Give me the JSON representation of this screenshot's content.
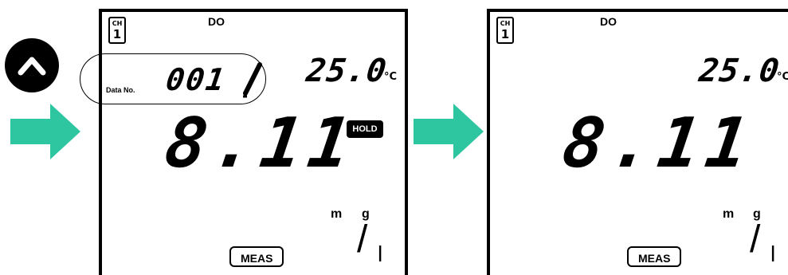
{
  "up_key": {
    "icon": "up-caret-icon",
    "color": "#000000"
  },
  "arrow_color": "#2ec6a0",
  "panels": [
    {
      "channel_label": "CH",
      "channel_number": "1",
      "mode": "DO",
      "data_no_label": "Data No.",
      "data_no_value": "001",
      "temperature": "25.0",
      "temperature_unit": "°C",
      "reading": "8.11",
      "hold_badge": "HOLD",
      "meas_badge": "MEAS",
      "unit_m": "m",
      "unit_g": "g",
      "unit_slash": "/",
      "unit_l": "l"
    },
    {
      "channel_label": "CH",
      "channel_number": "1",
      "mode": "DO",
      "temperature": "25.0",
      "temperature_unit": "°C",
      "reading": "8.11",
      "meas_badge": "MEAS",
      "unit_m": "m",
      "unit_g": "g",
      "unit_slash": "/",
      "unit_l": "l"
    }
  ]
}
